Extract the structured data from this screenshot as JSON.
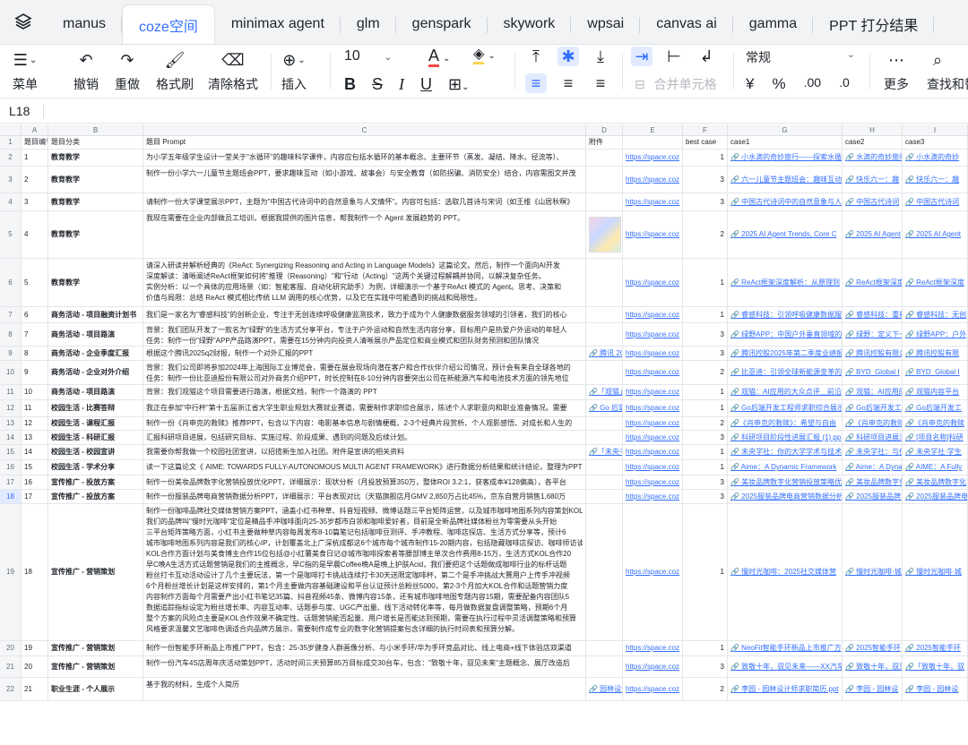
{
  "tabs": [
    "manus",
    "coze空间",
    "minimax agent",
    "glm",
    "genspark",
    "skywork",
    "wpsai",
    "canvas ai",
    "gamma",
    "PPT 打分结果"
  ],
  "toolbar": {
    "menu": "菜单",
    "undo": "撤销",
    "redo": "重做",
    "format_painter": "格式刷",
    "clear_format": "清除格式",
    "insert": "插入",
    "font_size": "10",
    "merge_cells": "合并单元格",
    "number_format": "常规",
    "currency": "¥",
    "percent": "%",
    "dec_increase": ".00",
    "dec_decrease": ".0",
    "more": "更多",
    "find": "查找和替换"
  },
  "name_box": "L18",
  "columns": [
    "A",
    "B",
    "C",
    "D",
    "E",
    "F",
    "G",
    "H",
    "I"
  ],
  "header_row": {
    "num": "1",
    "a": "题目编号",
    "b": "题目分类",
    "c": "题目 Prompt",
    "d": "附件",
    "e": "",
    "f": "best case",
    "g": "case1",
    "h": "case2",
    "i": "case3"
  },
  "rows": [
    {
      "num": "2",
      "a": "1",
      "b": "教育教学",
      "c": [
        "为小学五年级学生设计一堂关于\"水循环\"的趣味科学课件，内容应包括水循环的基本概念、主要环节（蒸发、凝结、降水、径流等）、"
      ],
      "d": "",
      "e": "https://space.coz",
      "f": "1",
      "g": "🔗 小水滴的奇妙旅行——探索水循环",
      "h": "🔗 水滴的奇妙旅行",
      "i": "🔗 小水滴的奇妙"
    },
    {
      "num": "3",
      "a": "2",
      "b": "教育教学",
      "c": [
        "制作一份小学六一儿童节主题班会PPT，要求趣味互动（如小游戏、故事会）与安全教育（如防拐骗、消防安全）结合，内容需图文并茂"
      ],
      "d": "",
      "e": "https://space.coz",
      "f": "3",
      "g": "🔗 六一儿童节主题班会：趣味互动",
      "h": "🔗 快乐六一：趣",
      "i": "🔗 快乐六一：趣"
    },
    {
      "num": "4",
      "a": "3",
      "b": "教育教学",
      "c": [
        "请制作一份大学课堂展示PPT，主题为\"中国古代诗词中的自然意象与人文情怀\"。内容可包括：选取几首诗与宋词（如王维《山居秋暝》"
      ],
      "d": "",
      "e": "https://space.coz",
      "f": "3",
      "g": "🔗 中国古代诗词中的自然意象与人文",
      "h": "🔗 中国古代诗词",
      "i": "🔗 中国古代诗词"
    },
    {
      "num": "5",
      "a": "4",
      "b": "教育教学",
      "c": [
        "我现在需要在企业内部做员工培训，根据我提供的图片信息，帮我制作一个 Agent 发展趋势的 PPT。"
      ],
      "d": "img",
      "e": "https://space.coz",
      "f": "2",
      "g": "🔗 2025 AI Agent Trends, Core C",
      "h": "🔗 2025 AI Agent",
      "i": "🔗 2025 AI Agent"
    },
    {
      "num": "6",
      "a": "5",
      "b": "教育教学",
      "c": [
        "请深入研读并解析经典的《ReAct: Synergizing Reasoning and Acting in Language Models》这篇论文。然后，制作一个面向AI开发",
        "深度解读：清晰阐述ReAct框架如何将\"推理（Reasoning）\"和\"行动（Acting）\"这两个关键过程解耦并协同，以解决复杂任务。",
        "实例分析：以一个具体的应用场景（如：智能客服、自动化研究助手）为例，详细演示一个基于ReAct 模式的 Agent。思考、决策和",
        "价值与局限：总结 ReAct 模式相比传统 LLM 调用的核心优势，以及它在实践中可能遇到的挑战和局限性。"
      ],
      "d": "",
      "e": "https://space.coz",
      "f": "1",
      "g": "🔗 ReAct框架深度解析：从原理到",
      "h": "🔗 ReAct框架深度",
      "i": "🔗 ReAct框架深度"
    },
    {
      "num": "7",
      "a": "6",
      "b": "商务活动 - 项目融资计划书",
      "c": [
        "我们是一家名为\"睿感科技\"的创新企业，专注于无创连续呼吸健康监测技术，致力于成为个人健康数据服务领域的引领者，我们的核心"
      ],
      "d": "",
      "e": "https://space.coz",
      "f": "1",
      "g": "🔗 睿感科技：引领呼吸健康数据服务",
      "h": "🔗 睿感科技：重新",
      "i": "🔗 睿感科技：无创"
    },
    {
      "num": "8",
      "a": "7",
      "b": "商务活动 - 项目路演",
      "c": [
        "背景：我们团队开发了一款名为\"绿野\"的生活方式分享平台，专注于户外运动和自然生活内容分享，目标用户是热爱户外运动的年轻人",
        "任务：制作一份\"绿野\"APP产品路演PPT，需要在15分钟内向投资人清晰展示产品定位和商业模式和团队财务预测和团队情况"
      ],
      "d": "",
      "e": "https://space.coz",
      "f": "3",
      "g": "🔗 绿野APP：中国户外垂直领域的",
      "h": "🔗 绿野：定义下一",
      "i": "🔗 绿野APP：户外"
    },
    {
      "num": "9",
      "a": "8",
      "b": "商务活动 - 企业季度汇报",
      "c": [
        "根据这个腾讯2025q2财报，制作一个对外汇报的PPT"
      ],
      "d": "🔗 腾讯 2025",
      "e": "https://space.coz",
      "f": "3",
      "g": "🔗 腾讯控股2025年第二季度业绩报告",
      "h": "🔗 腾讯控股有限公司",
      "i": "🔗 腾讯控股有限"
    },
    {
      "num": "10",
      "a": "9",
      "b": "商务活动 - 企业对外介绍",
      "c": [
        "背景：我们公司即将参加2024年上海国际工业博览会，需要在展会现场向潜在客户和合作伙伴介绍公司情况，预计会有来自全球各地的",
        "任务：制作一份比亚迪股份有限公司对外商务介绍PPT，时长控制在8-10分钟内容要突出公司在新能源汽车和电池技术方面的领先地位"
      ],
      "d": "",
      "e": "https://space.coz",
      "f": "2",
      "g": "🔗 比亚迪：引领全球新能源变革的",
      "h": "🔗 BYD_Global I",
      "i": "🔗 BYD_Global I"
    },
    {
      "num": "11",
      "a": "10",
      "b": "商务活动 - 项目路演",
      "c": [
        "背景：我们观猫这个项目需要进行路演，根据文档，制作一个路演的 PPT"
      ],
      "d": "🔗「观猫」",
      "e": "https://space.coz",
      "f": "1",
      "g": "🔗 观猫：AI应用的大众点评＿前沿",
      "h": "🔗 观猫：AI应用的",
      "i": "🔗 观猫内容平台"
    },
    {
      "num": "12",
      "a": "11",
      "b": "校园生活 - 比赛答辩",
      "c": [
        "我正在参加\"中行杯\"第十五届浙江省大学生职业规划大赛就业赛道，需要制作求职综合展示，陈述个人求职意向和职业准备情况。需要"
      ],
      "d": "🔗 Go 后端",
      "e": "https://space.coz",
      "f": "1",
      "g": "🔗 Go后端开发工程师求职综合展示",
      "h": "🔗 Go后端开发工",
      "i": "🔗 Go后端开发工"
    },
    {
      "num": "13",
      "a": "12",
      "b": "校园生活 - 课程汇报",
      "c": [
        "制作一份《肖申克的救赎》推荐PPT，包含以下内容：电影基本信息与剧情梗概、2-3个经典片段赏析、个人观影感悟、对成长和人生的"
      ],
      "d": "",
      "e": "https://space.coz",
      "f": "2",
      "g": "🔗《肖申克的救赎》：希望与自由",
      "h": "🔗《肖申克的救赎",
      "i": "🔗《肖申克的救赎"
    },
    {
      "num": "14",
      "a": "13",
      "b": "校园生活 - 科研汇报",
      "c": [
        "汇报科研项目进展，包括研究目标、实施过程、阶段成果、遇到的问题及后续计划。"
      ],
      "d": "",
      "e": "https://space.coz",
      "f": "3",
      "g": "🔗 科研项目阶段性进展汇报 (1).pp",
      "h": "🔗 科研项目进展汇",
      "i": "🔗 [项目名称]科研"
    },
    {
      "num": "15",
      "a": "14",
      "b": "校园生活 - 校园宣讲",
      "c": [
        "我需要你帮我做一个校园社团宣讲，以招揽新生加入社团。附件是宣讲的相关资料"
      ],
      "d": "🔗「未央书",
      "e": "https://space.coz",
      "f": "1",
      "g": "🔗 未央学社：你的大学学术与技术",
      "h": "🔗 未央学社：与你",
      "i": "🔗 未央学社·学生"
    },
    {
      "num": "16",
      "a": "15",
      "b": "校园生活 - 学术分享",
      "c": [
        "读一下这篇论文《 AIME: TOWARDS FULLY-AUTONOMOUS MULTI AGENT FRAMEWORK》进行数据分析结果和统计结论，整理为PPT"
      ],
      "d": "",
      "e": "https://space.coz",
      "f": "1",
      "g": "🔗 Aime：A Dynamic Framework",
      "h": "🔗 Aime：A Dyna",
      "i": "🔗 AIME：A Fully"
    },
    {
      "num": "17",
      "a": "16",
      "b": "宣传推广 - 投放方案",
      "c": [
        "制作一份美妆品牌数字化营销投放优化PPT，详细展示：现状分析（月投放预算350万，整体ROI 3.2:1，获客成本¥128偏高），各平台"
      ],
      "d": "",
      "e": "https://space.coz",
      "f": "3",
      "g": "🔗 美妆品牌数字化营销投放策略优",
      "h": "🔗 美妆品牌数字化",
      "i": "🔗 美妆品牌数字化"
    },
    {
      "num": "18",
      "a": "17",
      "b": "宣传推广 - 投放方案",
      "c": [
        "制作一份服装品牌电商营销数据分析PPT，详细展示：平台表现对比（天猫旗舰店月GMV 2,850万占比45%，京东自营月销售1,680万"
      ],
      "d": "",
      "e": "https://space.coz",
      "f": "3",
      "g": "🔗 2025服装品牌电商营销数据分析",
      "h": "🔗 2025服装品牌电",
      "i": "🔗 2025服装品牌电"
    },
    {
      "num": "19",
      "a": "18",
      "b": "宣传推广 - 营销策划",
      "c": [
        "制作一份咖啡品牌社交媒体营销方案PPT，涵盖小红书种草、抖音短视频、微博话题三平台矩阵运营，以及城市咖啡地图系列内容策划KOL",
        "我们的品牌叫\"慢时光咖啡\"定位是精品手冲咖啡面向25-35岁都市白领和咖啡爱好者，目前是全新品牌社媒体粉丝为零需要从头开始",
        "三平台矩阵策略方面，小红书主要做种草内容每周发布8-10篇笔记包括咖啡豆测评、手冲教程、咖啡店探店、生活方式分享等，预计6",
        "城市咖啡地图系列内容是我们的核心IP，计划覆盖北上广深杭成都这6个城市每个城市制作15-20期内容，包括隐藏咖啡店探访、咖啡师访谈",
        "KOL合作方面计划与美食博主合作15位包括@小红薯美食日记@城市咖啡探索者等腰部博主单次合作费用8-15万，生活方式KOL合作20",
        "早C晚A生活方式话题营销是我们的主推概念，早C指的是早晨Coffee晚A是晚上护肤Acid，我们要把这个话题做成咖啡行业的标杆话题",
        "粉丝打卡互动活动设计了几个主要玩法，第一个是咖啡打卡挑战连续打卡30天送限定咖啡杯，第二个是手冲挑战大赛用户上传手冲视频",
        "6个月粉丝增长计划是这样安排的，第1个月主要做内容基础建设和平台认证预计总粉丝5000，第2-3个月加大KOL合作和话题营销力度",
        "内容制作方面每个月需要产出小红书笔记35篇、抖音视频45条、微博内容15条，还有城市咖啡地图专题内容15期，需要配备内容团队5",
        "数据追踪指标设定为粉丝增长率、内容互动率、话题参与度、UGC产出量、线下活动转化率等，每月做数据复盘调整策略，预期6个月",
        "整个方案的风险点主要是KOL合作效果不确定性、话题营销能否起量、用户增长是否能达到预期，需要在执行过程中灵活调整策略和预算",
        "风格要求温馨文艺咖啡色调适合向品牌方展示，需要制作成专业的数字化营销提案包含详细的执行时间表和预算分解。"
      ],
      "d": "",
      "e": "https://space.coz",
      "f": "1",
      "g": "🔗 慢时光咖啡：2025社交媒体营",
      "h": "🔗 慢时光咖啡·城",
      "i": "🔗 慢时光咖啡·城"
    },
    {
      "num": "20",
      "a": "19",
      "b": "宣传推广 - 营销策划",
      "c": [
        "制作一份智能手环新品上市推广PPT，包含：25-35岁健身人群画像分析、与小米手环/华为手环竞品对比、线上电商+线下体验店双渠道"
      ],
      "d": "",
      "e": "https://space.coz",
      "f": "1",
      "g": "🔗 NeoFit智能手环新品上市推广方",
      "h": "🔗 2025智能手环",
      "i": "🔗 2025智能手环"
    },
    {
      "num": "21",
      "a": "20",
      "b": "宣传推广 - 营销策划",
      "c": [
        "制作一份汽车4S店周年庆活动策划PPT，活动时间三天预算85万目标成交30台车，包含：\"致敬十年，驭见未来\"主题概念、展厅改造后"
      ],
      "d": "",
      "e": "https://space.coz",
      "f": "3",
      "g": "🔗 致敬十年，驭见未来——XX汽车",
      "h": "🔗 致敬十年，驭见",
      "i": "🔗「致敬十年，驭"
    },
    {
      "num": "22",
      "a": "21",
      "b": "职业生涯 - 个人展示",
      "c": [
        "基于我的材料，生成个人简历"
      ],
      "d": "🔗 园林设计",
      "e": "https://space.coz",
      "f": "2",
      "g": "🔗 李园 - 园林设计师求职简历.ppt",
      "h": "🔗 李园 - 园林设",
      "i": "🔗 李园 - 园林设"
    }
  ]
}
